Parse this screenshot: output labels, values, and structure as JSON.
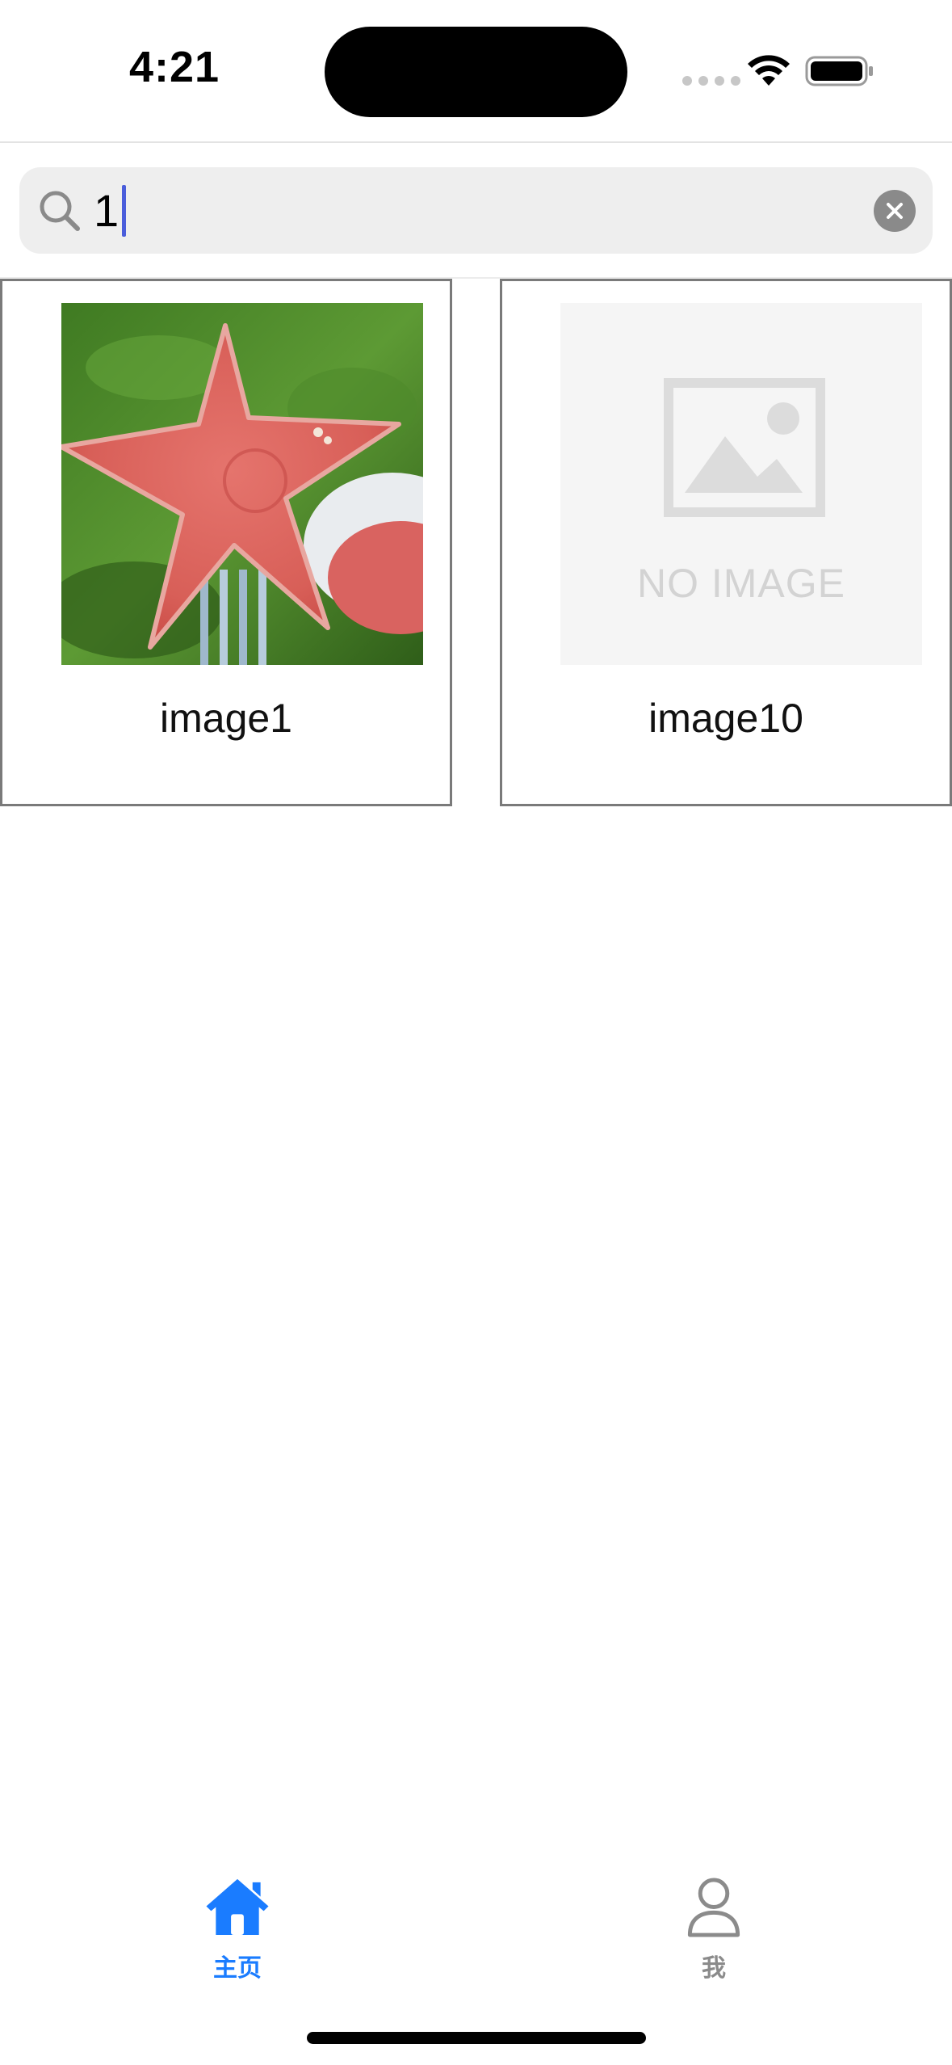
{
  "status_bar": {
    "time": "4:21"
  },
  "search": {
    "query": "1",
    "search_icon": "search-icon",
    "clear_icon": "clear-icon"
  },
  "results": [
    {
      "label": "image1",
      "thumbnail": "photo-star-watermelon"
    },
    {
      "label": "image10",
      "thumbnail": "no-image-placeholder",
      "placeholder_text": "NO IMAGE"
    }
  ],
  "tab_bar": {
    "tabs": [
      {
        "label": "主页",
        "icon": "home-icon",
        "active": true
      },
      {
        "label": "我",
        "icon": "person-icon",
        "active": false
      }
    ],
    "active_color": "#1a7cff",
    "inactive_color": "#8b8b8b"
  },
  "colors": {
    "search_background": "#eeeeee",
    "card_border": "#7a7a7a",
    "caret": "#4a5ddb"
  }
}
